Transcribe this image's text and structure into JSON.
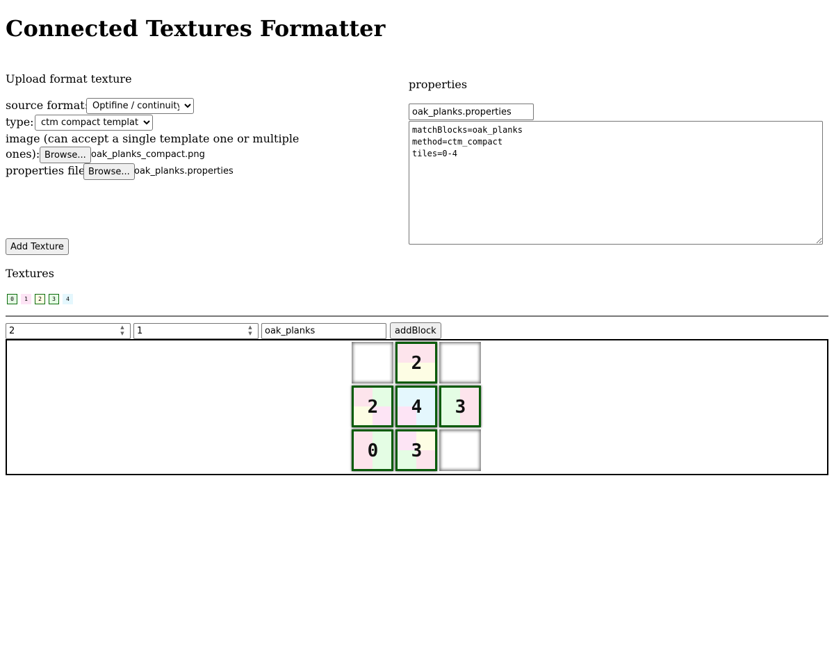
{
  "page": {
    "title": "Connected Textures Formatter"
  },
  "upload": {
    "heading": "Upload format texture",
    "source_format_label": "source format:",
    "source_format_value": "Optifine / continuity",
    "type_label": "type:",
    "type_value": "ctm compact template",
    "image_label_line1": "image (can accept a single template one or multiple",
    "image_label_line2": "ones):",
    "browse_label": "Browse...",
    "image_file": "oak_planks_compact.png",
    "properties_label": "properties file",
    "properties_file": "oak_planks.properties",
    "add_texture_label": "Add Texture"
  },
  "properties": {
    "heading": "properties",
    "filename": "oak_planks.properties",
    "content": "matchBlocks=oak_planks\nmethod=ctm_compact\ntiles=0-4"
  },
  "textures": {
    "heading": "Textures",
    "thumbs": [
      {
        "label": "0",
        "bg": "#e4f7e4",
        "border": "#0a6b0a"
      },
      {
        "label": "1",
        "bg": "#fde4f5",
        "border": "#fde4f5"
      },
      {
        "label": "2",
        "bg": "#fdfde4",
        "border": "#0a6b0a"
      },
      {
        "label": "3",
        "bg": "#e4fde4",
        "border": "#0a6b0a"
      },
      {
        "label": "4",
        "bg": "#e4f7fd",
        "border": "#e4f7fd"
      }
    ]
  },
  "block_controls": {
    "x_value": "2",
    "y_value": "1",
    "name_value": "oak_planks",
    "add_block_label": "addBlock"
  },
  "grid": {
    "cells": [
      {
        "label": "",
        "empty": true
      },
      {
        "label": "2",
        "empty": false,
        "colors": [
          "#fde4ec",
          "#fde4ec",
          "#fdfde4",
          "#fdfde4"
        ]
      },
      {
        "label": "",
        "empty": true
      },
      {
        "label": "2",
        "empty": false,
        "colors": [
          "#fde4ec",
          "#e4fde4",
          "#fdfde4",
          "#fde4f5"
        ]
      },
      {
        "label": "4",
        "empty": false,
        "colors": [
          "#e4f7fd",
          "#e4f7fd",
          "#fde4f5",
          "#e4f7fd"
        ]
      },
      {
        "label": "3",
        "empty": false,
        "colors": [
          "#e4fde4",
          "#fde4ec",
          "#e4fde4",
          "#fde4ec"
        ]
      },
      {
        "label": "0",
        "empty": false,
        "colors": [
          "#fde4ec",
          "#e4fde4",
          "#fde4ec",
          "#e4fde4"
        ]
      },
      {
        "label": "3",
        "empty": false,
        "colors": [
          "#fde4f5",
          "#fdfde4",
          "#e4fde4",
          "#fde4ec"
        ]
      },
      {
        "label": "",
        "empty": true
      }
    ]
  },
  "colors": {
    "tile_border": "#0a5b0a"
  }
}
